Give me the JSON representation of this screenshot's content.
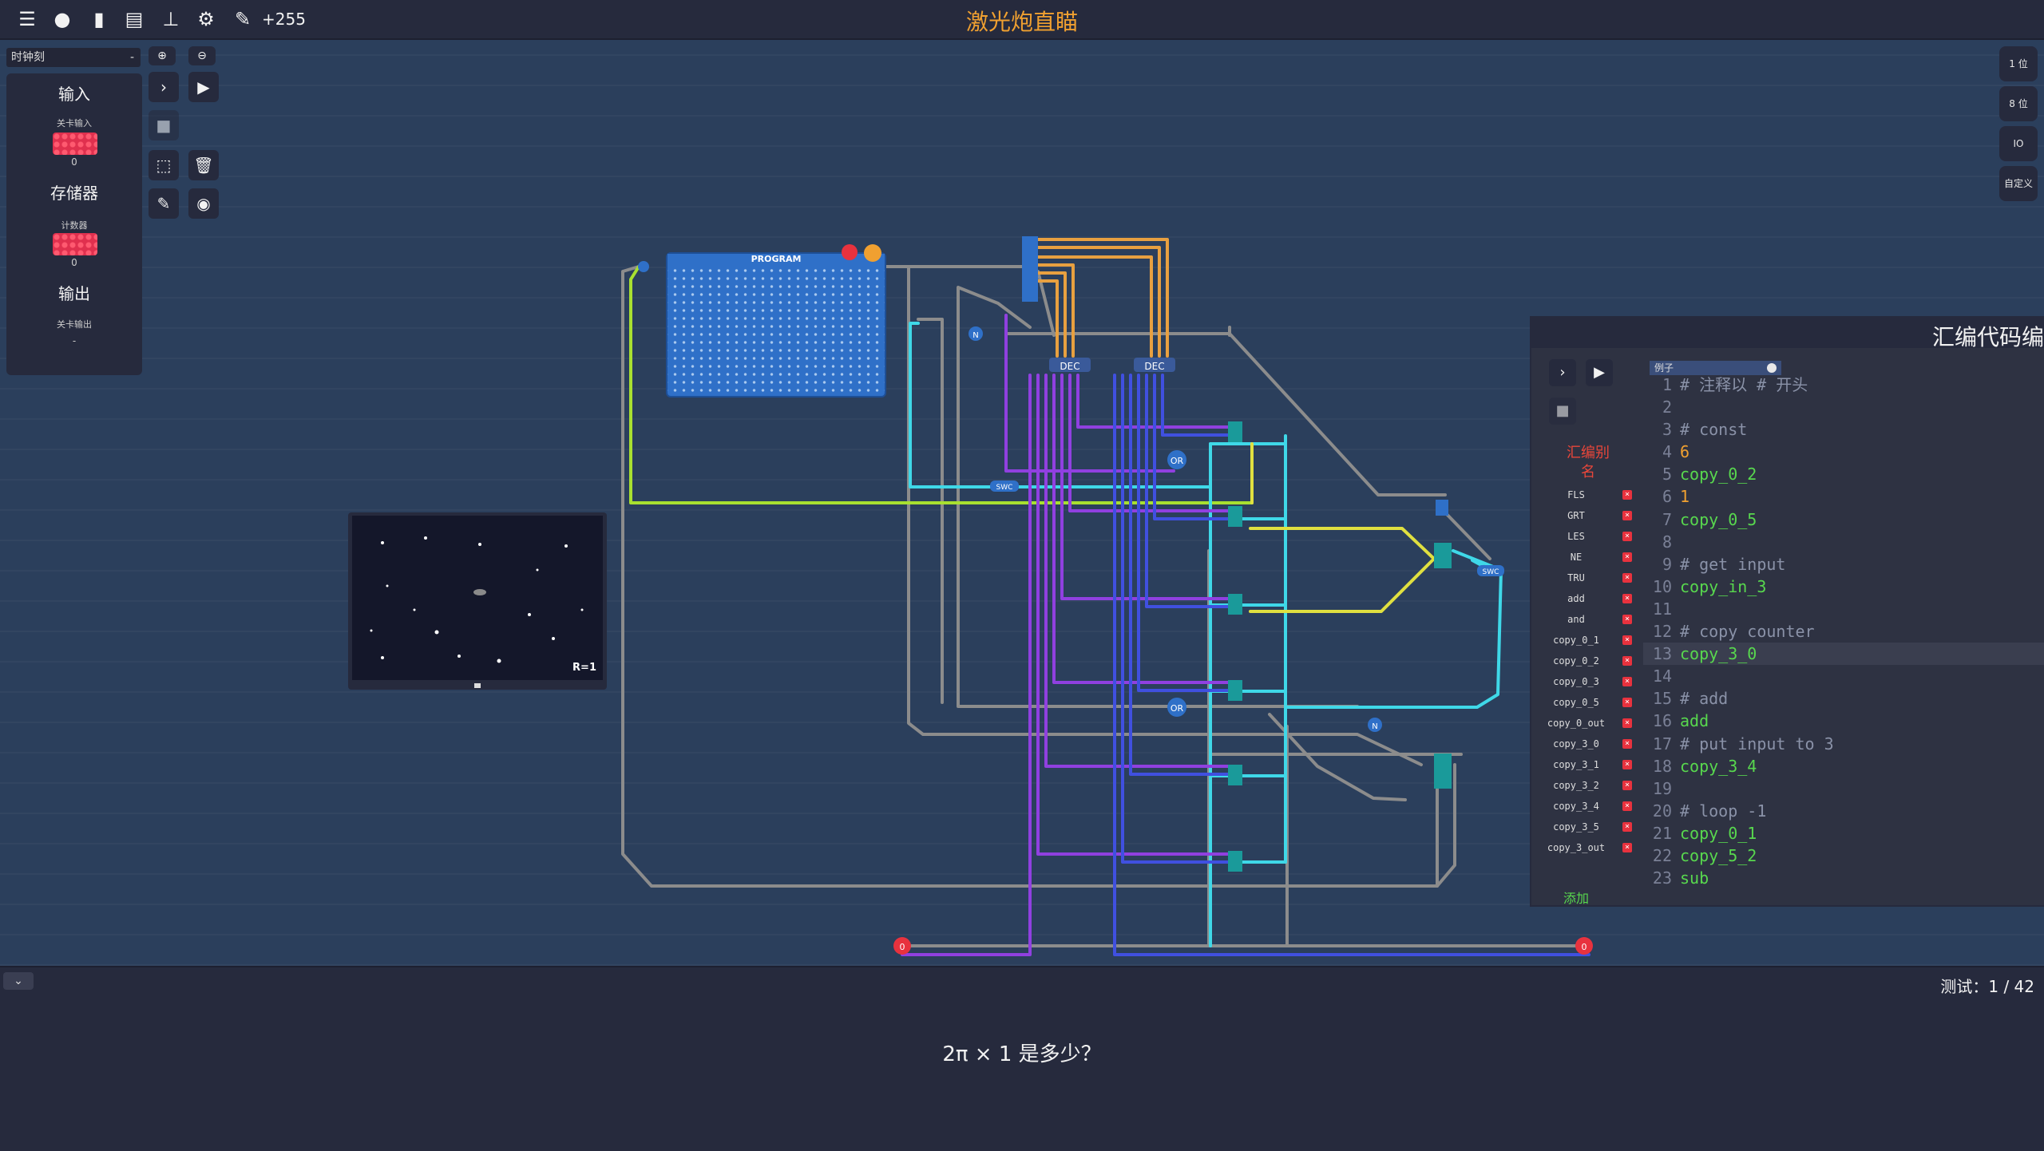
{
  "topbar": {
    "score": "+255",
    "title": "激光炮直瞄",
    "icons": [
      "menu-icon",
      "chat-icon",
      "file-icon",
      "book-icon",
      "hierarchy-icon",
      "gear-icon",
      "wrench-icon"
    ]
  },
  "left_panel": {
    "clock_select": "时钟刻",
    "clock_select_dash": "-",
    "sections": [
      {
        "heading": "输入",
        "sub": "关卡输入",
        "value": "0"
      },
      {
        "heading": "存储器",
        "sub": "计数器",
        "value": "0"
      },
      {
        "heading": "输出",
        "sub": "关卡输出",
        "value": "-"
      }
    ]
  },
  "right_buttons": [
    "1 位",
    "8 位",
    "IO",
    "自定义"
  ],
  "program_component": {
    "title": "PROGRAM"
  },
  "screen": {
    "label": "R=1"
  },
  "editor": {
    "title": "汇编代码编",
    "example_select": "例子",
    "alias_title": "汇编别名",
    "aliases": [
      "FLS",
      "GRT",
      "LES",
      "NE",
      "TRU",
      "add",
      "and",
      "copy_0_1",
      "copy_0_2",
      "copy_0_3",
      "copy_0_5",
      "copy_0_out",
      "copy_3_0",
      "copy_3_1",
      "copy_3_2",
      "copy_3_4",
      "copy_3_5",
      "copy_3_out"
    ],
    "add_label": "添加",
    "code_lines": [
      {
        "n": "1",
        "t": "# 注释以 # 开头",
        "k": "comment"
      },
      {
        "n": "2",
        "t": "",
        "k": "code"
      },
      {
        "n": "3",
        "t": "# const",
        "k": "comment"
      },
      {
        "n": "4",
        "t": "6",
        "k": "num"
      },
      {
        "n": "5",
        "t": "copy_0_2",
        "k": "code"
      },
      {
        "n": "6",
        "t": "1",
        "k": "num"
      },
      {
        "n": "7",
        "t": "copy_0_5",
        "k": "code"
      },
      {
        "n": "8",
        "t": "",
        "k": "code"
      },
      {
        "n": "9",
        "t": "# get input",
        "k": "comment"
      },
      {
        "n": "10",
        "t": "copy_in_3",
        "k": "code"
      },
      {
        "n": "11",
        "t": "",
        "k": "code"
      },
      {
        "n": "12",
        "t": "# copy counter",
        "k": "comment"
      },
      {
        "n": "13",
        "t": "copy_3_0",
        "k": "code"
      },
      {
        "n": "14",
        "t": "",
        "k": "code"
      },
      {
        "n": "15",
        "t": "# add",
        "k": "comment"
      },
      {
        "n": "16",
        "t": "add",
        "k": "code"
      },
      {
        "n": "17",
        "t": "# put input to 3",
        "k": "comment"
      },
      {
        "n": "18",
        "t": "copy_3_4",
        "k": "code"
      },
      {
        "n": "19",
        "t": "",
        "k": "code"
      },
      {
        "n": "20",
        "t": "# loop -1",
        "k": "comment"
      },
      {
        "n": "21",
        "t": "copy_0_1",
        "k": "code"
      },
      {
        "n": "22",
        "t": "copy_5_2",
        "k": "code"
      },
      {
        "n": "23",
        "t": "sub",
        "k": "code"
      }
    ],
    "highlighted_line": "13"
  },
  "circuit_labels": {
    "or1": "OR",
    "or2": "OR",
    "n1": "N",
    "n2": "N",
    "swc1": "SWC",
    "swc2": "SWC",
    "dec1": "DEC",
    "dec2": "DEC",
    "pin_left": "0",
    "pin_right": "0"
  },
  "bottom": {
    "test_status": "测试：1 / 42",
    "question": "2π × 1 是多少？"
  },
  "colors": {
    "accent": "#f0a030",
    "wire_gray": "#8c8c8c",
    "wire_cyan": "#3fd8e8",
    "wire_purple": "#9040e0",
    "wire_green": "#a8e030",
    "wire_yellow": "#e0e040",
    "wire_orange": "#e8a040",
    "wire_blue": "#4050e0"
  }
}
